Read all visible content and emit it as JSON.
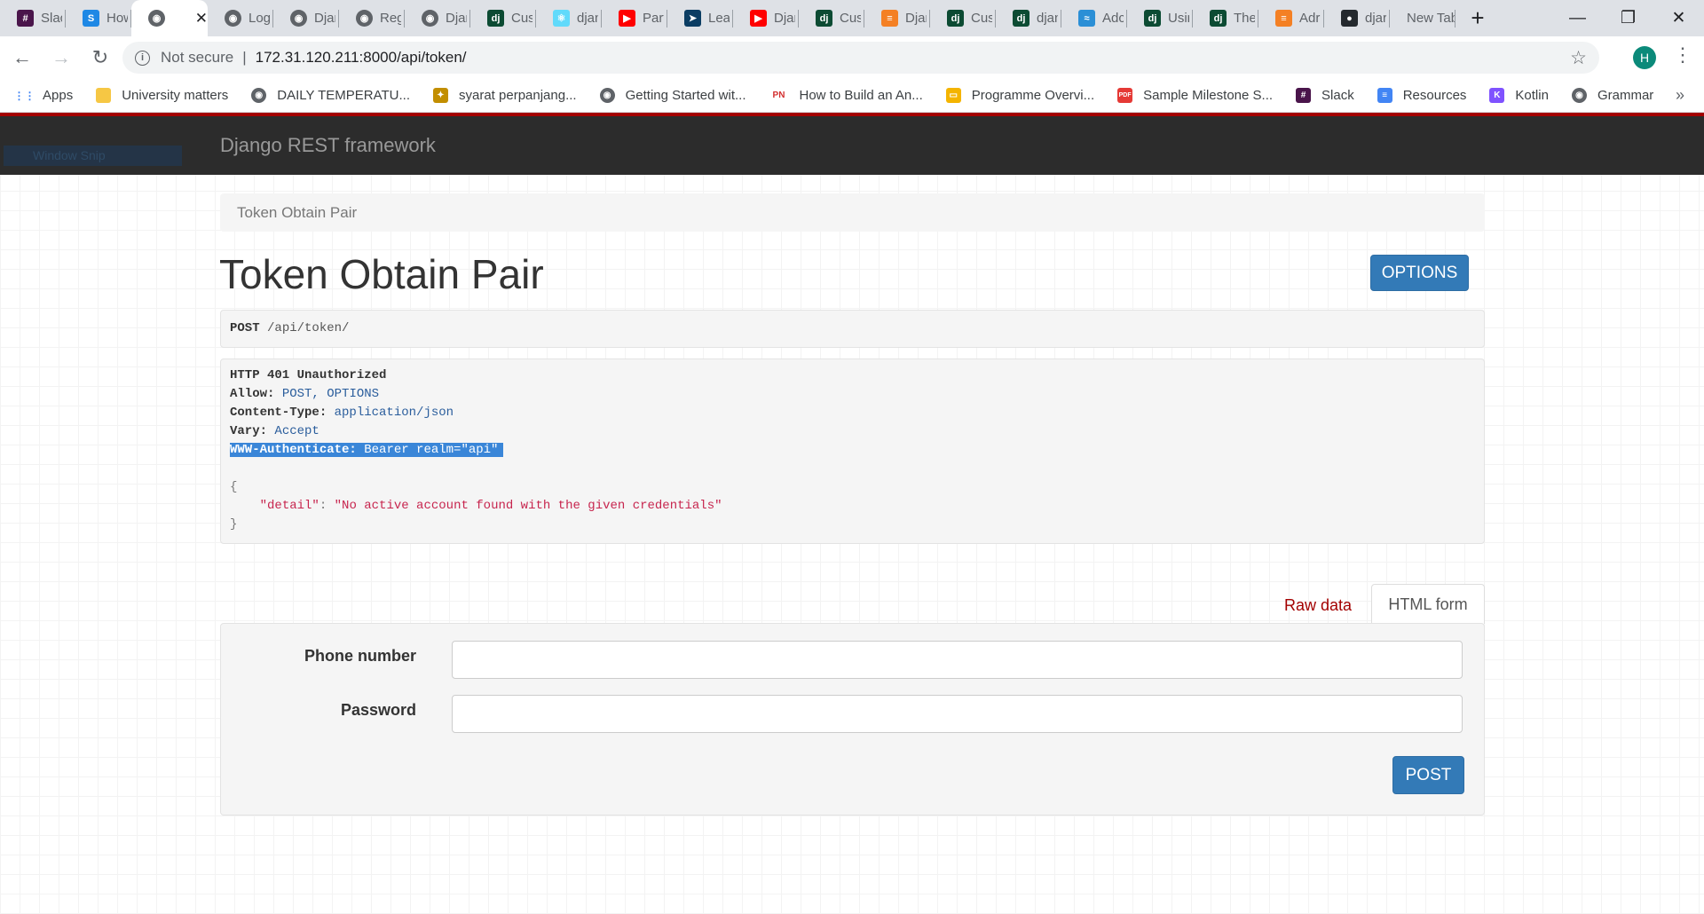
{
  "browser": {
    "tabs": [
      {
        "title": "Slack",
        "icon": "slack-icon",
        "color": "#4a154b",
        "glyph": "#"
      },
      {
        "title": "How",
        "icon": "s-icon",
        "color": "#1e88e5",
        "glyph": "S"
      },
      {
        "title": "",
        "icon": "globe-icon",
        "color": "#5f6368",
        "glyph": "◉",
        "active": true
      },
      {
        "title": "Log",
        "icon": "globe-icon",
        "color": "#5f6368",
        "glyph": "◉"
      },
      {
        "title": "Djan",
        "icon": "globe-icon",
        "color": "#5f6368",
        "glyph": "◉"
      },
      {
        "title": "Reg",
        "icon": "globe-icon",
        "color": "#5f6368",
        "glyph": "◉"
      },
      {
        "title": "Djan",
        "icon": "globe-icon",
        "color": "#5f6368",
        "glyph": "◉"
      },
      {
        "title": "Cus",
        "icon": "django-icon",
        "color": "#0c4b33",
        "glyph": "dj"
      },
      {
        "title": "djan",
        "icon": "react-icon",
        "color": "#61dafb",
        "glyph": "⚛"
      },
      {
        "title": "Part",
        "icon": "youtube-icon",
        "color": "#ff0000",
        "glyph": "▶"
      },
      {
        "title": "Lea",
        "icon": "arrow-icon",
        "color": "#0b3d63",
        "glyph": "➤"
      },
      {
        "title": "Djan",
        "icon": "youtube-icon",
        "color": "#ff0000",
        "glyph": "▶"
      },
      {
        "title": "Cus",
        "icon": "django-icon",
        "color": "#0c4b33",
        "glyph": "dj"
      },
      {
        "title": "Djan",
        "icon": "stackoverflow-icon",
        "color": "#f48024",
        "glyph": "≡"
      },
      {
        "title": "Cus",
        "icon": "django-icon",
        "color": "#0c4b33",
        "glyph": "dj"
      },
      {
        "title": "djan",
        "icon": "django-icon",
        "color": "#0c4b33",
        "glyph": "dj"
      },
      {
        "title": "Adc",
        "icon": "water-icon",
        "color": "#2b8fd6",
        "glyph": "≈"
      },
      {
        "title": "Usin",
        "icon": "django-icon",
        "color": "#0c4b33",
        "glyph": "dj"
      },
      {
        "title": "The",
        "icon": "django-icon",
        "color": "#0c4b33",
        "glyph": "dj"
      },
      {
        "title": "Adr",
        "icon": "stackoverflow-icon",
        "color": "#f48024",
        "glyph": "≡"
      },
      {
        "title": "djar",
        "icon": "github-icon",
        "color": "#24292e",
        "glyph": "●"
      }
    ],
    "newtab_title": "New Tab",
    "omnibox": {
      "security": "Not secure",
      "url": "172.31.120.211:8000/api/token/"
    },
    "profile_initial": "H",
    "bookmarks": [
      {
        "label": "Apps",
        "icon": "apps-grid-icon",
        "color": "#4285f4",
        "glyph": "⋮⋮"
      },
      {
        "label": "University matters",
        "icon": "folder-icon",
        "color": "#f6c744",
        "glyph": ""
      },
      {
        "label": "DAILY TEMPERATU...",
        "icon": "globe-icon",
        "color": "#5f6368",
        "glyph": "◉"
      },
      {
        "label": "syarat perpanjang...",
        "icon": "garuda-icon",
        "color": "#c28e00",
        "glyph": "✦"
      },
      {
        "label": "Getting Started wit...",
        "icon": "globe-icon",
        "color": "#5f6368",
        "glyph": "◉"
      },
      {
        "label": "How to Build an An...",
        "icon": "pn-icon",
        "color": "#ffffff",
        "glyph": "PN"
      },
      {
        "label": "Programme Overvi...",
        "icon": "slides-icon",
        "color": "#f4b400",
        "glyph": "▭"
      },
      {
        "label": "Sample Milestone S...",
        "icon": "pdf-icon",
        "color": "#e53935",
        "glyph": "PDF"
      },
      {
        "label": "Slack",
        "icon": "slack-icon",
        "color": "#4a154b",
        "glyph": "#"
      },
      {
        "label": "Resources",
        "icon": "docs-icon",
        "color": "#4285f4",
        "glyph": "≡"
      },
      {
        "label": "Kotlin",
        "icon": "kotlin-icon",
        "color": "#7f52ff",
        "glyph": "K"
      },
      {
        "label": "Grammar",
        "icon": "globe-icon",
        "color": "#5f6368",
        "glyph": "◉"
      }
    ]
  },
  "page": {
    "brand": "Django REST framework",
    "snip_overlay": "Window Snip",
    "breadcrumb": "Token Obtain Pair",
    "title": "Token Obtain Pair",
    "options_button": "OPTIONS",
    "request": {
      "method": "POST",
      "path": "/api/token/"
    },
    "response": {
      "status": "HTTP 401 Unauthorized",
      "headers": [
        {
          "key": "Allow:",
          "value": "POST, OPTIONS"
        },
        {
          "key": "Content-Type:",
          "value": "application/json"
        },
        {
          "key": "Vary:",
          "value": "Accept"
        },
        {
          "key": "WWW-Authenticate:",
          "value": "Bearer realm=\"api\""
        }
      ],
      "body_open": "{",
      "body_key": "\"detail\"",
      "body_colon": ": ",
      "body_value": "\"No active account found with the given credentials\"",
      "body_close": "}"
    },
    "form_tabs": {
      "raw": "Raw data",
      "html": "HTML form"
    },
    "form": {
      "fields": [
        {
          "label": "Phone number",
          "value": ""
        },
        {
          "label": "Password",
          "value": ""
        }
      ],
      "submit": "POST"
    }
  }
}
